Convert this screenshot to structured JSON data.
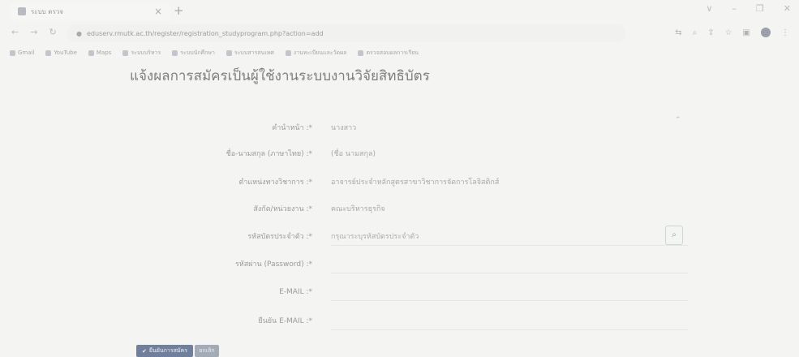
{
  "browser": {
    "tab_title": "ระบบ ตรวจ",
    "tab_close": "×",
    "new_tab": "+",
    "window_controls": [
      "∨",
      "–",
      "❐",
      "✕"
    ],
    "url": "eduserv.rmutk.ac.th/register/registration_studyprogram.php?action=add",
    "bookmarks": [
      "Gmail",
      "YouTube",
      "Maps",
      "ระบบบริหาร",
      "ระบบนักศึกษา",
      "ระบบสารสนเทศ",
      "งานทะเบียนและวัดผล",
      "ตรวจสอบผลการเรียน"
    ]
  },
  "page": {
    "title": "แจ้งผลการสมัครเป็นผู้ใช้งานระบบงานวิจัยสิทธิบัตร",
    "corner_mark": "⌃"
  },
  "form": {
    "fields": [
      {
        "label": "คำนำหน้า :*",
        "value": "นางสาว"
      },
      {
        "label": "ชื่อ-นามสกุล (ภาษาไทย) :*",
        "value": "(ชื่อ นามสกุล)"
      },
      {
        "label": "ตำแหน่งทางวิชาการ :*",
        "value": "อาจารย์ประจำหลักสูตรสาขาวิชาการจัดการโลจิสติกส์"
      },
      {
        "label": "สังกัด/หน่วยงาน :*",
        "value": "คณะบริหารธุรกิจ"
      },
      {
        "label": "รหัสบัตรประจำตัว :*",
        "value": "กรุณาระบุรหัสบัตรประจำตัว"
      },
      {
        "label": "รหัสผ่าน (Password) :*",
        "value": ""
      },
      {
        "label": "E-MAIL :*",
        "value": ""
      },
      {
        "label": "ยืนยัน E-MAIL :*",
        "value": ""
      }
    ]
  },
  "actions": {
    "submit": "ยืนยันการสมัคร",
    "cancel": "ยกเลิก"
  },
  "colors": {
    "submit_bg": "#6f7f9c",
    "cancel_bg": "#a3abb7"
  }
}
